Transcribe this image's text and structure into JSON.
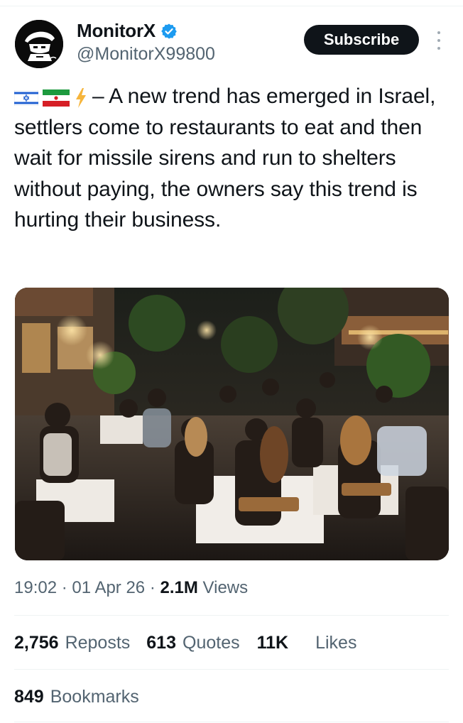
{
  "author": {
    "name": "MonitorX",
    "handle": "@MonitorX99800",
    "verified": true,
    "avatar_icon": "masked-figure-logo-icon"
  },
  "actions": {
    "subscribe_label": "Subscribe",
    "more_icon": "vertical-ellipsis-icon"
  },
  "post": {
    "lead_icons": [
      "israel-flag-icon",
      "iran-flag-icon",
      "lightning-icon"
    ],
    "text": "– A new trend has emerged in Israel, settlers come to restaurants to eat and then wait for missile sirens and run to shelters without paying, the owners say this trend is hurting their business."
  },
  "media": {
    "icon": "photo-crowded-outdoor-restaurant-night"
  },
  "meta": {
    "time": "19:02",
    "sep1": "·",
    "date": "01 Apr 26",
    "sep2": "·",
    "views_count": "2.1M",
    "views_label": "Views"
  },
  "stats": {
    "reposts_count": "2,756",
    "reposts_label": "Reposts",
    "quotes_count": "613",
    "quotes_label": "Quotes",
    "likes_count": "11K",
    "likes_label": "Likes",
    "bookmarks_count": "849",
    "bookmarks_label": "Bookmarks"
  },
  "colors": {
    "text_primary": "#0f1419",
    "text_secondary": "#536471",
    "verified_blue": "#1d9bf0",
    "button_bg": "#0f1419",
    "divider": "#eff3f4"
  }
}
